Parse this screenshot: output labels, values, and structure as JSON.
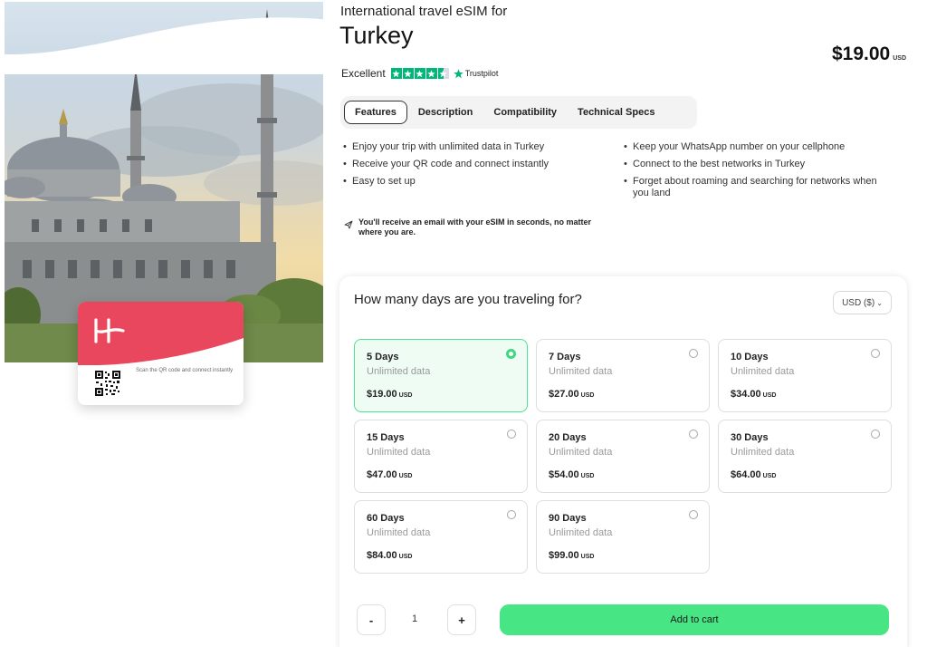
{
  "product": {
    "eyebrow": "International travel eSIM for",
    "title": "Turkey",
    "price": "$19.00",
    "currency_code": "USD"
  },
  "rating": {
    "label": "Excellent",
    "stars": 4.5,
    "provider": "Trustpilot",
    "color": "#00b67a"
  },
  "tabs": [
    {
      "label": "Features",
      "active": true
    },
    {
      "label": "Description",
      "active": false
    },
    {
      "label": "Compatibility",
      "active": false
    },
    {
      "label": "Technical Specs",
      "active": false
    }
  ],
  "features_left": [
    "Enjoy your trip with unlimited data in Turkey",
    "Receive your QR code and connect instantly",
    "Easy to set up"
  ],
  "features_right": [
    "Keep your WhatsApp number on your cellphone",
    "Connect to the best networks in Turkey",
    "Forget about roaming and searching for networks when you land"
  ],
  "email_note": "You'll receive an email with your eSIM in seconds, no matter where you are.",
  "sim_card": {
    "text": "Scan the QR code and connect instantly",
    "brand_color": "#e8475e"
  },
  "plans_panel": {
    "title": "How many days are you traveling for?",
    "currency_select": "USD ($)",
    "currency_code": "USD",
    "plans": [
      {
        "days": "5 Days",
        "data": "Unlimited data",
        "price": "$19.00",
        "selected": true
      },
      {
        "days": "7 Days",
        "data": "Unlimited data",
        "price": "$27.00",
        "selected": false
      },
      {
        "days": "10 Days",
        "data": "Unlimited data",
        "price": "$34.00",
        "selected": false
      },
      {
        "days": "15 Days",
        "data": "Unlimited data",
        "price": "$47.00",
        "selected": false
      },
      {
        "days": "20 Days",
        "data": "Unlimited data",
        "price": "$54.00",
        "selected": false
      },
      {
        "days": "30 Days",
        "data": "Unlimited data",
        "price": "$64.00",
        "selected": false
      },
      {
        "days": "60 Days",
        "data": "Unlimited data",
        "price": "$84.00",
        "selected": false
      },
      {
        "days": "90 Days",
        "data": "Unlimited data",
        "price": "$99.00",
        "selected": false
      }
    ]
  },
  "cart": {
    "minus_label": "-",
    "quantity": "1",
    "plus_label": "+",
    "add_label": "Add to cart",
    "button_color": "#47e584"
  },
  "icons": {
    "rating_star": "star-icon",
    "trustpilot": "trustpilot-star-icon",
    "email_note": "paper-plane-icon",
    "currency": "chevron-down-icon"
  }
}
